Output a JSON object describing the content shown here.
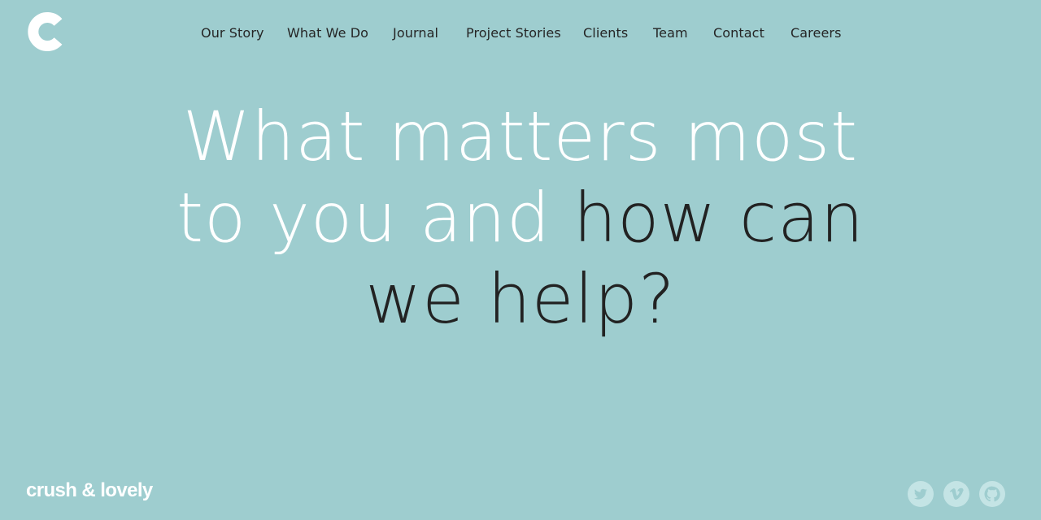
{
  "brand": {
    "logo_icon": "c-logo-icon",
    "wordmark": "crush & lovely"
  },
  "nav": {
    "items": [
      {
        "label": "Our Story"
      },
      {
        "label": "What We Do"
      },
      {
        "label": "Journal"
      },
      {
        "label": "Project Stories"
      },
      {
        "label": "Clients"
      },
      {
        "label": "Team"
      },
      {
        "label": "Contact"
      },
      {
        "label": "Careers"
      }
    ]
  },
  "hero": {
    "line1": "What matters most",
    "line2_light": "to you and ",
    "line2_dark": "how can",
    "line3": "we help?"
  },
  "social": [
    {
      "icon": "twitter-icon"
    },
    {
      "icon": "vimeo-icon"
    },
    {
      "icon": "github-icon"
    }
  ],
  "colors": {
    "background": "#9ecdcf",
    "text_light": "#ffffff",
    "text_dark": "#222222",
    "social_icon": "#c4e4e5"
  }
}
